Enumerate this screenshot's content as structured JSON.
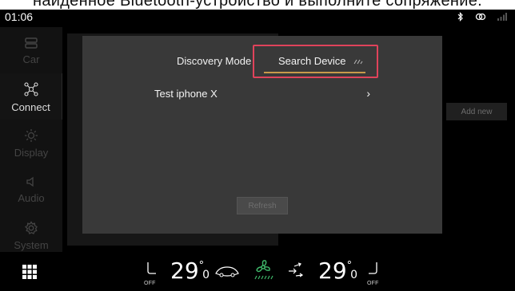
{
  "caption": {
    "text": "найденное Bluetooth-устройство и выполните сопряжение."
  },
  "status_bar": {
    "time": "01:06",
    "icons": [
      "bluetooth-icon",
      "link-icon",
      "signal-icon"
    ]
  },
  "sidebar": {
    "items": [
      {
        "label": "Car",
        "icon": "car-seat-icon",
        "active": false
      },
      {
        "label": "Connect",
        "icon": "connect-icon",
        "active": true
      },
      {
        "label": "Display",
        "icon": "brightness-icon",
        "active": false
      },
      {
        "label": "Audio",
        "icon": "speaker-icon",
        "active": false
      },
      {
        "label": "System",
        "icon": "gear-icon",
        "active": false
      }
    ]
  },
  "background": {
    "add_new_label": "Add new"
  },
  "dialog": {
    "discovery_label": "Discovery Mode",
    "search_label": "Search Device",
    "devices": [
      {
        "name": "Test iphone X"
      }
    ],
    "refresh_label": "Refresh"
  },
  "climate": {
    "left_temp": {
      "whole": "29",
      "decimal": "0"
    },
    "right_temp": {
      "whole": "29",
      "decimal": "0"
    },
    "left_seat_heat": "OFF",
    "right_seat_heat": "OFF"
  },
  "colors": {
    "highlight_border": "#e0435b",
    "tab_underline": "#c89a4a",
    "fan_green": "#3fb86a"
  }
}
